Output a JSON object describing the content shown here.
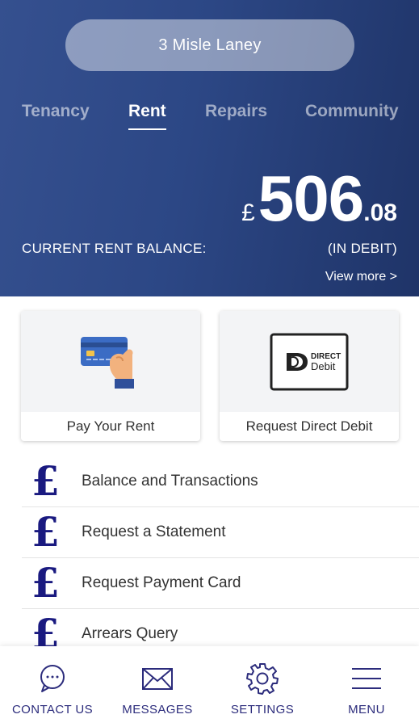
{
  "header": {
    "address": "3 Misle Laney",
    "tabs": [
      "Tenancy",
      "Rent",
      "Repairs",
      "Community"
    ],
    "active_tab": "Rent",
    "balance": {
      "currency": "£",
      "pounds": "506",
      "pence": ".08",
      "label": "CURRENT RENT BALANCE:",
      "status": "(IN DEBIT)",
      "view_more": "View more >"
    }
  },
  "cards": [
    {
      "label": "Pay Your Rent",
      "icon": "credit-card-hand-icon"
    },
    {
      "label": "Request Direct Debit",
      "icon": "direct-debit-icon"
    }
  ],
  "direct_debit_logo": {
    "line1": "DIRECT",
    "line2": "Debit"
  },
  "list": [
    {
      "label": "Balance and Transactions",
      "icon": "pound-icon"
    },
    {
      "label": "Request a Statement",
      "icon": "pound-icon"
    },
    {
      "label": "Request Payment Card",
      "icon": "pound-icon"
    },
    {
      "label": "Arrears Query",
      "icon": "pound-icon"
    }
  ],
  "list_icon_glyph": "£",
  "bottom_nav": [
    {
      "label": "CONTACT US",
      "icon": "chat-bubble-icon"
    },
    {
      "label": "MESSAGES",
      "icon": "envelope-icon"
    },
    {
      "label": "SETTINGS",
      "icon": "gear-icon"
    },
    {
      "label": "MENU",
      "icon": "hamburger-menu-icon"
    }
  ],
  "colors": {
    "header_bg": "#2c4785",
    "accent_navy": "#1a1a80",
    "nav_text": "#2c2c7c"
  }
}
